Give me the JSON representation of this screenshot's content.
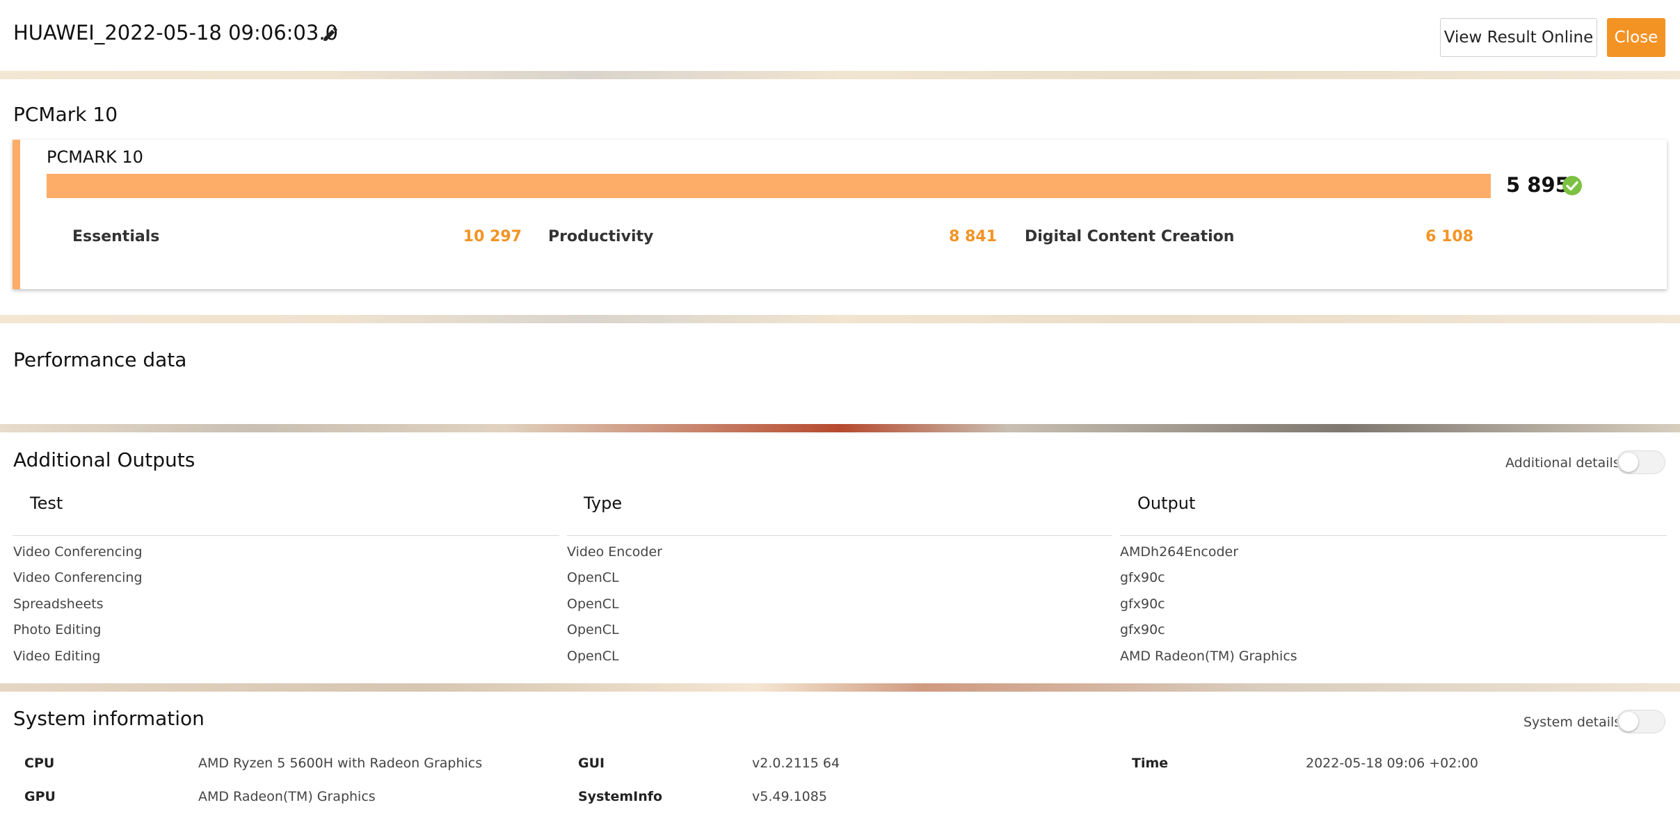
{
  "header": {
    "title": "HUAWEI_2022-05-18 09:06:03.0",
    "view_online_label": "View Result Online",
    "close_label": "Close"
  },
  "benchmark": {
    "section_title": "PCMark 10",
    "card_title": "PCMARK 10",
    "overall_score": "5 895",
    "bar_fill_fraction": 1.0,
    "subscores": [
      {
        "label": "Essentials",
        "value": "10 297"
      },
      {
        "label": "Productivity",
        "value": "8 841"
      },
      {
        "label": "Digital Content Creation",
        "value": "6 108"
      }
    ]
  },
  "performance": {
    "section_title": "Performance data"
  },
  "outputs": {
    "section_title": "Additional Outputs",
    "toggle_label": "Additional details",
    "columns": [
      "Test",
      "Type",
      "Output"
    ],
    "rows": [
      [
        "Video Conferencing",
        "Video Encoder",
        "AMDh264Encoder"
      ],
      [
        "Video Conferencing",
        "OpenCL",
        "gfx90c"
      ],
      [
        "Spreadsheets",
        "OpenCL",
        "gfx90c"
      ],
      [
        "Photo Editing",
        "OpenCL",
        "gfx90c"
      ],
      [
        "Video Editing",
        "OpenCL",
        "AMD Radeon(TM) Graphics"
      ]
    ]
  },
  "system": {
    "section_title": "System information",
    "toggle_label": "System details",
    "items": [
      {
        "key": "CPU",
        "value": "AMD Ryzen 5 5600H with Radeon Graphics"
      },
      {
        "key": "GUI",
        "value": "v2.0.2115 64"
      },
      {
        "key": "Time",
        "value": "2022-05-18 09:06 +02:00"
      },
      {
        "key": "GPU",
        "value": "AMD Radeon(TM) Graphics"
      },
      {
        "key": "SystemInfo",
        "value": "v5.49.1085"
      }
    ]
  },
  "colors": {
    "accent": "#f39324",
    "bar": "#fdad68",
    "check": "#7cc142"
  },
  "icons": {
    "edit": "pencil-icon",
    "check": "check-circle-icon"
  }
}
